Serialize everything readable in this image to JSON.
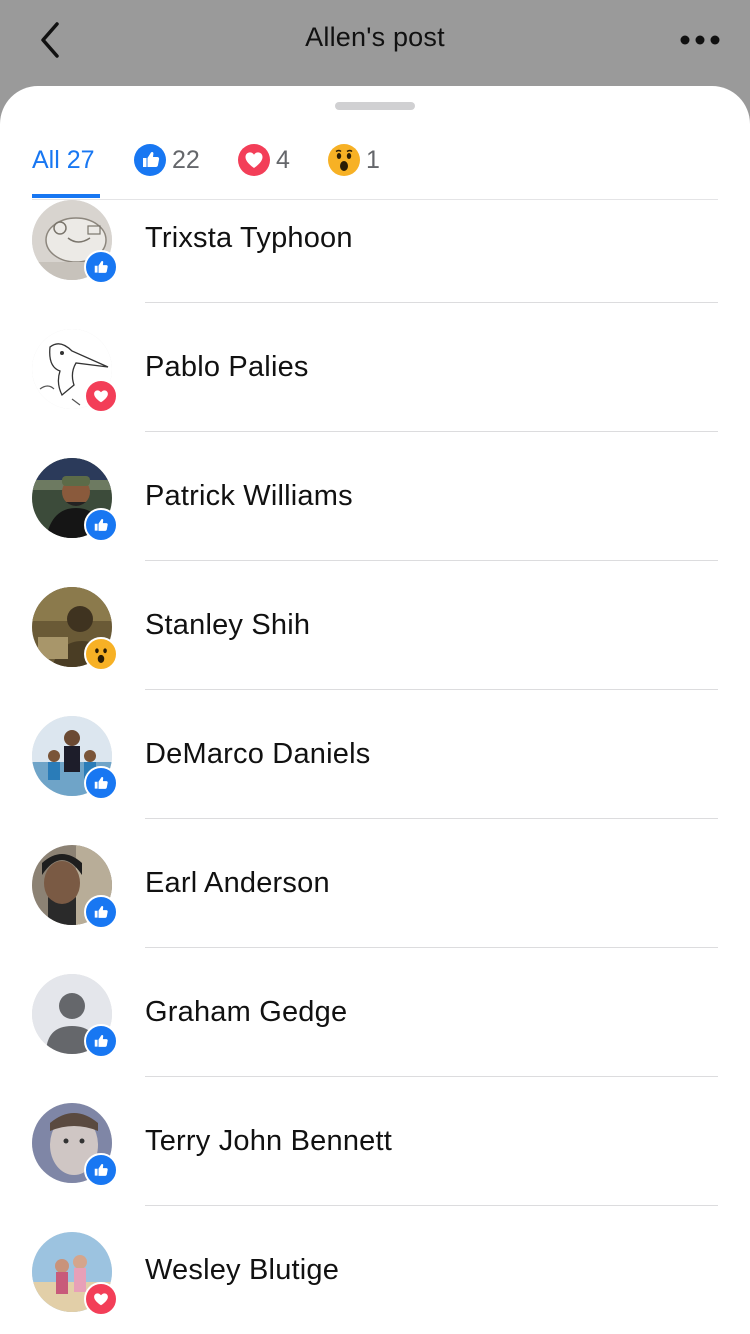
{
  "header": {
    "title": "Allen's post",
    "back_icon": "chevron-left-icon",
    "more_icon": "more-horizontal-icon"
  },
  "tabs": [
    {
      "label": "All 27",
      "icon": null,
      "active": true
    },
    {
      "label": "22",
      "icon": "like-icon",
      "active": false
    },
    {
      "label": "4",
      "icon": "love-icon",
      "active": false
    },
    {
      "label": "1",
      "icon": "wow-icon",
      "active": false
    }
  ],
  "colors": {
    "accent": "#1877f2",
    "like": "#1877f2",
    "love": "#f33e58",
    "wow": "#f7b125"
  },
  "people": [
    {
      "name": "Trixsta Typhoon",
      "reaction": "like"
    },
    {
      "name": "Pablo Palies",
      "reaction": "love"
    },
    {
      "name": "Patrick Williams",
      "reaction": "like"
    },
    {
      "name": "Stanley Shih",
      "reaction": "wow"
    },
    {
      "name": "DeMarco Daniels",
      "reaction": "like"
    },
    {
      "name": "Earl Anderson",
      "reaction": "like"
    },
    {
      "name": "Graham Gedge",
      "reaction": "like"
    },
    {
      "name": "Terry John Bennett",
      "reaction": "like"
    },
    {
      "name": "Wesley Blutige",
      "reaction": "love"
    }
  ]
}
